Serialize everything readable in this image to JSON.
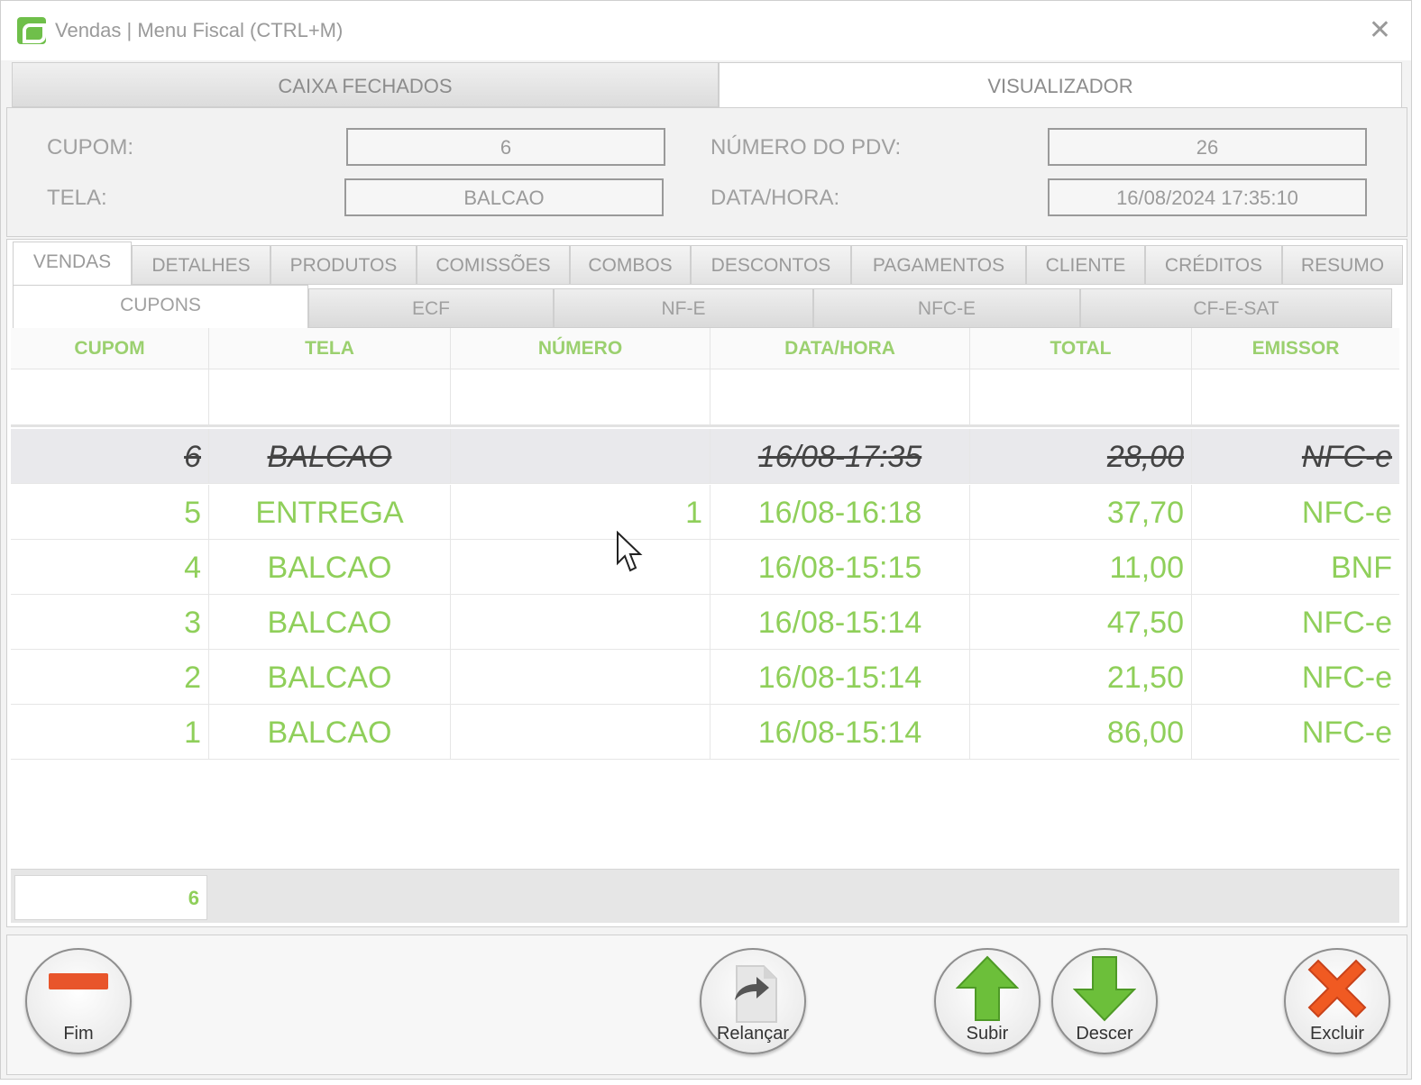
{
  "window": {
    "title": "Vendas | Menu Fiscal (CTRL+M)"
  },
  "top_tabs": [
    {
      "label": "CAIXA FECHADOS",
      "active": false
    },
    {
      "label": "VISUALIZADOR",
      "active": true
    }
  ],
  "header": {
    "cupom_label": "CUPOM:",
    "cupom_value": "6",
    "tela_label": "TELA:",
    "tela_value": "BALCAO",
    "pdv_label": "NÚMERO DO PDV:",
    "pdv_value": "26",
    "datahora_label": "DATA/HORA:",
    "datahora_value": "16/08/2024 17:35:10"
  },
  "tabs": [
    "VENDAS",
    "DETALHES",
    "PRODUTOS",
    "COMISSÕES",
    "COMBOS",
    "DESCONTOS",
    "PAGAMENTOS",
    "CLIENTE",
    "CRÉDITOS",
    "RESUMO"
  ],
  "active_tab": "VENDAS",
  "subtabs": [
    "CUPONS",
    "ECF",
    "NF-E",
    "NFC-E",
    "CF-E-SAT"
  ],
  "active_subtab": "CUPONS",
  "grid": {
    "columns": [
      "CUPOM",
      "TELA",
      "NÚMERO",
      "DATA/HORA",
      "TOTAL",
      "EMISSOR"
    ],
    "rows": [
      {
        "cupom": "6",
        "tela": "BALCAO",
        "numero": "",
        "datahora": "16/08-17:35",
        "total": "28,00",
        "emissor": "NFC-e",
        "cancelled": true
      },
      {
        "cupom": "5",
        "tela": "ENTREGA",
        "numero": "1",
        "datahora": "16/08-16:18",
        "total": "37,70",
        "emissor": "NFC-e",
        "cancelled": false
      },
      {
        "cupom": "4",
        "tela": "BALCAO",
        "numero": "",
        "datahora": "16/08-15:15",
        "total": "11,00",
        "emissor": "BNF",
        "cancelled": false
      },
      {
        "cupom": "3",
        "tela": "BALCAO",
        "numero": "",
        "datahora": "16/08-15:14",
        "total": "47,50",
        "emissor": "NFC-e",
        "cancelled": false
      },
      {
        "cupom": "2",
        "tela": "BALCAO",
        "numero": "",
        "datahora": "16/08-15:14",
        "total": "21,50",
        "emissor": "NFC-e",
        "cancelled": false
      },
      {
        "cupom": "1",
        "tela": "BALCAO",
        "numero": "",
        "datahora": "16/08-15:14",
        "total": "86,00",
        "emissor": "NFC-e",
        "cancelled": false
      }
    ],
    "footer_count": "6"
  },
  "toolbar": {
    "fim": "Fim",
    "relancar": "Relançar",
    "subir": "Subir",
    "descer": "Descer",
    "excluir": "Excluir"
  },
  "icons": {
    "fim": "minus-icon",
    "relancar": "redo-document-icon",
    "subir": "arrow-up-icon",
    "descer": "arrow-down-icon",
    "excluir": "x-icon"
  },
  "colors": {
    "accent_green": "#8fcf5a",
    "header_green": "#9bd06f",
    "fim_red": "#e8552b",
    "excluir_orange": "#f05a22",
    "arrow_green": "#6cbf3a"
  }
}
